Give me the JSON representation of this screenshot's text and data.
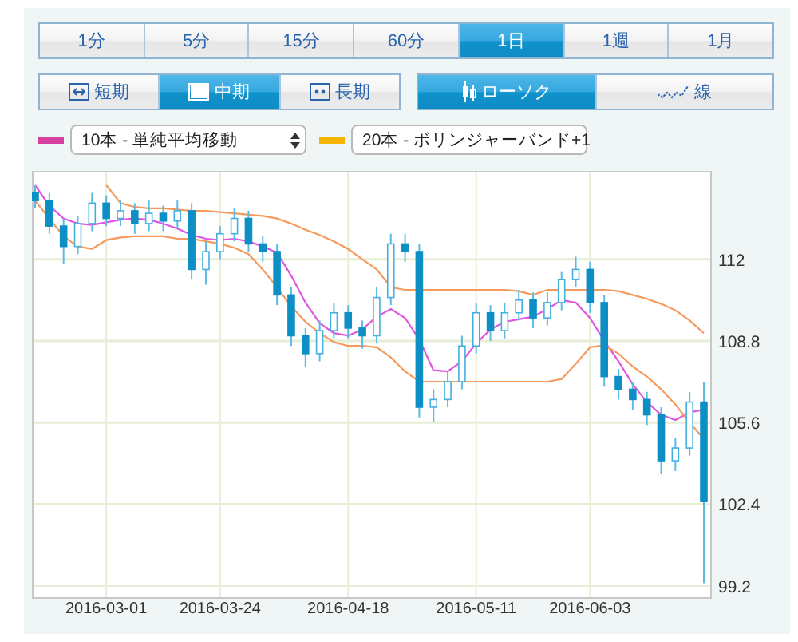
{
  "timeframes": [
    {
      "label": "1分",
      "selected": false
    },
    {
      "label": "5分",
      "selected": false
    },
    {
      "label": "15分",
      "selected": false
    },
    {
      "label": "60分",
      "selected": false
    },
    {
      "label": "1日",
      "selected": true
    },
    {
      "label": "1週",
      "selected": false
    },
    {
      "label": "1月",
      "selected": false
    }
  ],
  "ranges": [
    {
      "label": "短期",
      "kind": "short",
      "selected": false
    },
    {
      "label": "中期",
      "kind": "medium",
      "selected": true
    },
    {
      "label": "長期",
      "kind": "long",
      "selected": false
    }
  ],
  "chart_types": [
    {
      "label": "ローソク",
      "kind": "candle",
      "selected": true
    },
    {
      "label": "線",
      "kind": "line",
      "selected": false
    }
  ],
  "indicators": [
    {
      "value": "10本 - 単純平均移動",
      "color": "#d6409f"
    },
    {
      "value": "20本 - ボリンジャーバンド+1",
      "color": "#f5b400"
    }
  ],
  "chart": {
    "chart_data": {
      "type": "candlestick",
      "grid": true,
      "ylim": [
        98.75,
        115.4
      ],
      "yticks": [
        {
          "value": 112,
          "label": "112"
        },
        {
          "value": 108.8,
          "label": "108.8"
        },
        {
          "value": 105.6,
          "label": "105.6"
        },
        {
          "value": 102.4,
          "label": "102.4"
        },
        {
          "value": 99.2,
          "label": "99.2"
        }
      ],
      "categories": [
        null,
        null,
        null,
        null,
        null,
        "2016-03-01",
        null,
        null,
        null,
        null,
        null,
        null,
        null,
        "2016-03-24",
        null,
        null,
        null,
        null,
        null,
        null,
        null,
        null,
        "2016-04-18",
        null,
        null,
        null,
        null,
        null,
        null,
        null,
        null,
        "2016-05-11",
        null,
        null,
        null,
        null,
        null,
        null,
        null,
        "2016-06-03",
        null,
        null,
        null,
        null,
        null,
        null,
        null,
        null
      ],
      "ohlc": [
        [
          114.6,
          114.9,
          114.0,
          114.3
        ],
        [
          114.3,
          114.6,
          113.0,
          113.3
        ],
        [
          113.3,
          113.6,
          111.8,
          112.5
        ],
        [
          112.5,
          113.7,
          112.2,
          113.4
        ],
        [
          113.4,
          114.6,
          113.1,
          114.2
        ],
        [
          114.2,
          114.5,
          113.3,
          113.6
        ],
        [
          113.6,
          114.3,
          113.3,
          113.9
        ],
        [
          113.9,
          114.2,
          113.0,
          113.4
        ],
        [
          113.4,
          114.3,
          113.1,
          113.8
        ],
        [
          113.8,
          114.1,
          113.1,
          113.5
        ],
        [
          113.5,
          114.3,
          113.2,
          113.9
        ],
        [
          113.9,
          114.2,
          111.2,
          111.6
        ],
        [
          111.6,
          112.7,
          111.0,
          112.3
        ],
        [
          112.3,
          113.3,
          112.0,
          113.0
        ],
        [
          113.0,
          114.0,
          112.7,
          113.6
        ],
        [
          113.6,
          113.9,
          112.3,
          112.6
        ],
        [
          112.6,
          112.9,
          111.9,
          112.3
        ],
        [
          112.3,
          112.6,
          110.2,
          110.6
        ],
        [
          110.6,
          110.9,
          108.6,
          109.0
        ],
        [
          109.0,
          109.3,
          107.8,
          108.3
        ],
        [
          108.3,
          109.6,
          108.0,
          109.2
        ],
        [
          109.2,
          110.3,
          108.9,
          109.9
        ],
        [
          109.9,
          110.2,
          108.9,
          109.3
        ],
        [
          109.3,
          109.6,
          108.5,
          109.0
        ],
        [
          109.0,
          110.9,
          108.7,
          110.5
        ],
        [
          110.5,
          113.0,
          110.2,
          112.6
        ],
        [
          112.6,
          113.0,
          111.9,
          112.3
        ],
        [
          112.3,
          112.6,
          105.8,
          106.2
        ],
        [
          106.2,
          106.9,
          105.6,
          106.5
        ],
        [
          106.5,
          107.6,
          106.2,
          107.2
        ],
        [
          107.2,
          109.0,
          106.9,
          108.6
        ],
        [
          108.6,
          110.3,
          108.3,
          109.9
        ],
        [
          109.9,
          110.2,
          108.8,
          109.2
        ],
        [
          109.2,
          110.3,
          108.9,
          109.9
        ],
        [
          109.9,
          110.8,
          109.6,
          110.4
        ],
        [
          110.4,
          110.7,
          109.3,
          109.7
        ],
        [
          109.7,
          110.7,
          109.4,
          110.3
        ],
        [
          110.3,
          111.5,
          110.0,
          111.2
        ],
        [
          111.2,
          112.1,
          110.9,
          111.6
        ],
        [
          111.6,
          111.9,
          109.9,
          110.3
        ],
        [
          110.3,
          110.6,
          107.0,
          107.4
        ],
        [
          107.4,
          107.7,
          106.5,
          106.9
        ],
        [
          106.9,
          107.2,
          106.1,
          106.5
        ],
        [
          106.5,
          106.8,
          105.5,
          105.9
        ],
        [
          105.9,
          106.2,
          103.6,
          104.1
        ],
        [
          104.1,
          105.0,
          103.7,
          104.6
        ],
        [
          104.6,
          106.8,
          104.3,
          106.4
        ],
        [
          106.4,
          107.2,
          99.3,
          102.5
        ]
      ],
      "series": [
        {
          "type": "line",
          "color": "#e056e0",
          "values": [
            114.9,
            114.1,
            113.6,
            113.4,
            113.35,
            113.45,
            113.55,
            113.6,
            113.55,
            113.4,
            113.2,
            112.95,
            112.8,
            112.75,
            112.8,
            112.7,
            112.5,
            112.25,
            111.35,
            110.3,
            109.5,
            109.1,
            109.0,
            109.25,
            109.75,
            110.05,
            109.7,
            108.85,
            107.65,
            107.6,
            108.0,
            108.7,
            109.25,
            109.55,
            109.65,
            109.75,
            110.05,
            110.4,
            110.3,
            109.7,
            108.8,
            108.0,
            107.1,
            106.4,
            105.9,
            105.7,
            106.0,
            106.1
          ]
        },
        {
          "type": "line",
          "color": "#f59a5c",
          "values": [
            null,
            null,
            null,
            null,
            null,
            114.9,
            114.2,
            114.05,
            114.0,
            114.0,
            113.95,
            113.9,
            113.9,
            113.85,
            113.8,
            113.75,
            113.7,
            113.6,
            113.4,
            113.15,
            112.95,
            112.7,
            112.4,
            112.0,
            111.6,
            110.9,
            110.8,
            110.8,
            110.8,
            110.8,
            110.8,
            110.8,
            110.8,
            110.8,
            110.75,
            110.6,
            110.8,
            110.8,
            110.8,
            110.8,
            110.8,
            110.75,
            110.6,
            110.45,
            110.25,
            110.0,
            109.6,
            109.1
          ]
        },
        {
          "type": "line",
          "color": "#f59a5c",
          "values": [
            114.3,
            113.6,
            112.9,
            112.5,
            112.4,
            112.75,
            112.85,
            112.9,
            112.9,
            112.9,
            112.8,
            112.8,
            112.7,
            112.6,
            112.45,
            112.2,
            111.6,
            110.9,
            110.15,
            109.55,
            109.1,
            108.75,
            108.6,
            108.6,
            108.55,
            108.15,
            107.6,
            107.2,
            107.2,
            107.2,
            107.2,
            107.2,
            107.2,
            107.2,
            107.2,
            107.2,
            107.2,
            107.3,
            107.9,
            108.55,
            108.63,
            108.3,
            107.8,
            107.4,
            106.9,
            106.3,
            105.6,
            104.95
          ]
        }
      ]
    }
  }
}
